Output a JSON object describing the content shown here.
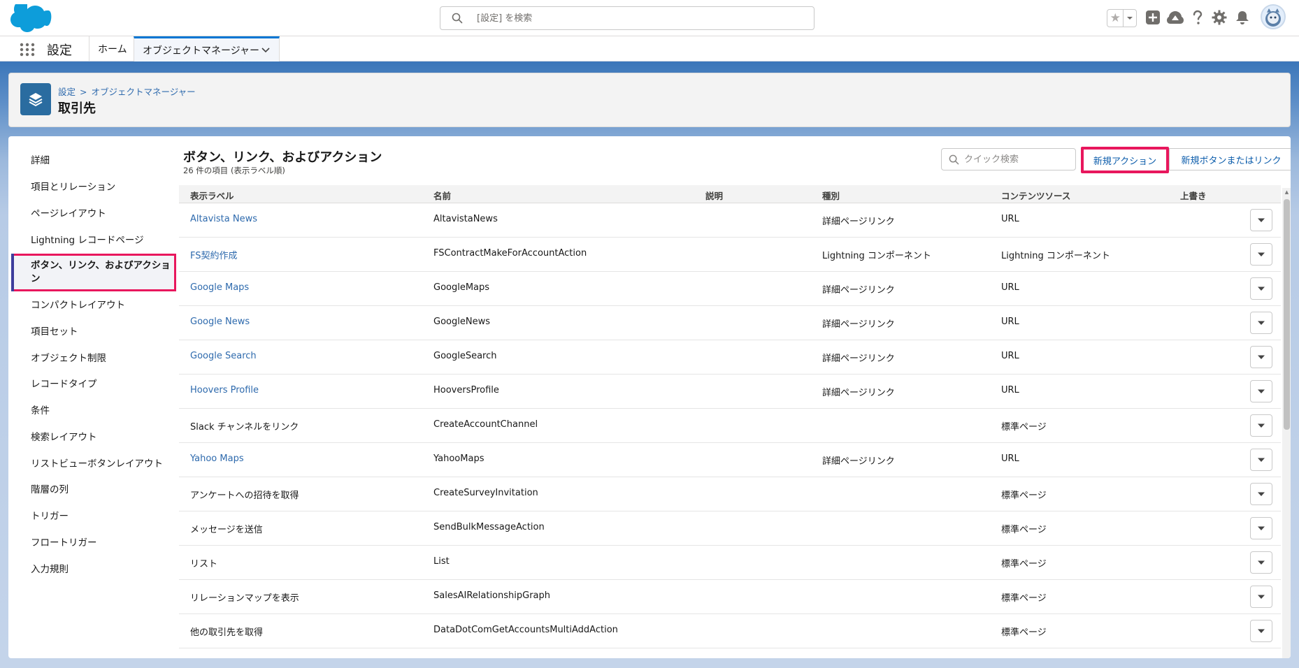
{
  "header": {
    "search_placeholder": "[設定] を検索"
  },
  "context_bar": {
    "app_name": "設定",
    "tabs": [
      {
        "label": "ホーム"
      },
      {
        "label": "オブジェクトマネージャー"
      }
    ]
  },
  "page_header": {
    "breadcrumb": [
      "設定",
      "オブジェクトマネージャー"
    ],
    "breadcrumb_sep": ">",
    "title": "取引先"
  },
  "sidebar": {
    "items": [
      {
        "label": "詳細"
      },
      {
        "label": "項目とリレーション"
      },
      {
        "label": "ページレイアウト"
      },
      {
        "label": "Lightning レコードページ"
      },
      {
        "label": "ボタン、リンク、およびアクション",
        "active": true
      },
      {
        "label": "コンパクトレイアウト"
      },
      {
        "label": "項目セット"
      },
      {
        "label": "オブジェクト制限"
      },
      {
        "label": "レコードタイプ"
      },
      {
        "label": "条件"
      },
      {
        "label": "検索レイアウト"
      },
      {
        "label": "リストビューボタンレイアウト"
      },
      {
        "label": "階層の列"
      },
      {
        "label": "トリガー"
      },
      {
        "label": "フロートリガー"
      },
      {
        "label": "入力規則"
      }
    ]
  },
  "content": {
    "title": "ボタン、リンク、およびアクション",
    "subtitle": "26 件の項目 (表示ラベル順)",
    "quick_search_placeholder": "クイック検索",
    "new_action_label": "新規アクション",
    "new_button_label": "新規ボタンまたはリンク",
    "highlight_color": "#e8175d"
  },
  "table": {
    "columns": [
      "表示ラベル",
      "名前",
      "説明",
      "種別",
      "コンテンツソース",
      "上書き"
    ],
    "rows": [
      {
        "label": "Altavista News",
        "name": "AltavistaNews",
        "description": "",
        "type": "詳細ページリンク",
        "source": "URL",
        "link": true
      },
      {
        "label": "FS契約作成",
        "name": "FSContractMakeForAccountAction",
        "description": "",
        "type": "Lightning コンポーネント",
        "source": "Lightning コンポーネント",
        "link": true
      },
      {
        "label": "Google Maps",
        "name": "GoogleMaps",
        "description": "",
        "type": "詳細ページリンク",
        "source": "URL",
        "link": true
      },
      {
        "label": "Google News",
        "name": "GoogleNews",
        "description": "",
        "type": "詳細ページリンク",
        "source": "URL",
        "link": true
      },
      {
        "label": "Google Search",
        "name": "GoogleSearch",
        "description": "",
        "type": "詳細ページリンク",
        "source": "URL",
        "link": true
      },
      {
        "label": "Hoovers Profile",
        "name": "HooversProfile",
        "description": "",
        "type": "詳細ページリンク",
        "source": "URL",
        "link": true
      },
      {
        "label": "Slack チャンネルをリンク",
        "name": "CreateAccountChannel",
        "description": "",
        "type": "",
        "source": "標準ページ",
        "link": false
      },
      {
        "label": "Yahoo Maps",
        "name": "YahooMaps",
        "description": "",
        "type": "詳細ページリンク",
        "source": "URL",
        "link": true
      },
      {
        "label": "アンケートへの招待を取得",
        "name": "CreateSurveyInvitation",
        "description": "",
        "type": "",
        "source": "標準ページ",
        "link": false
      },
      {
        "label": "メッセージを送信",
        "name": "SendBulkMessageAction",
        "description": "",
        "type": "",
        "source": "標準ページ",
        "link": false
      },
      {
        "label": "リスト",
        "name": "List",
        "description": "",
        "type": "",
        "source": "標準ページ",
        "link": false
      },
      {
        "label": "リレーションマップを表示",
        "name": "SalesAIRelationshipGraph",
        "description": "",
        "type": "",
        "source": "標準ページ",
        "link": false
      },
      {
        "label": "他の取引先を取得",
        "name": "DataDotComGetAccountsMultiAddAction",
        "description": "",
        "type": "",
        "source": "標準ページ",
        "link": false
      }
    ]
  },
  "icons": {
    "logo": "salesforce-cloud-logo",
    "search": "search-icon",
    "favorites": "star-icon",
    "add": "plus-icon",
    "trailhead": "trailhead-icon",
    "help": "question-icon",
    "setup": "gear-icon",
    "notifications": "bell-icon",
    "app_launcher": "waffle-icon",
    "object": "layers-icon",
    "row_menu": "chevron-down-icon"
  },
  "colors": {
    "brand_blue": "#0176d3",
    "link": "#2e6aad",
    "object_icon_bg": "#2a6ca0"
  }
}
